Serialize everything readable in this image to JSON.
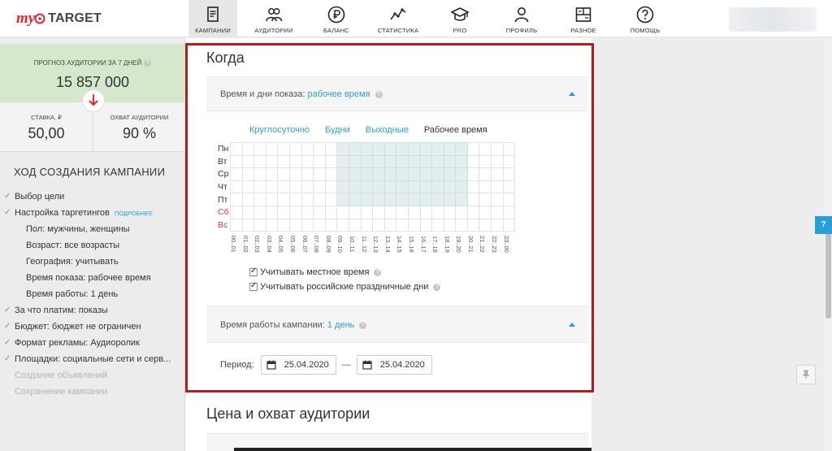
{
  "logo": {
    "my": "my",
    "target": "TARGET"
  },
  "nav": [
    {
      "label": "КАМПАНИИ",
      "icon": "campaigns-icon",
      "active": true
    },
    {
      "label": "АУДИТОРИИ",
      "icon": "audiences-icon",
      "active": false
    },
    {
      "label": "БАЛАНС",
      "icon": "ruble-icon",
      "active": false
    },
    {
      "label": "СТАТИСТИКА",
      "icon": "stats-icon",
      "active": false
    },
    {
      "label": "PRO",
      "icon": "graduation-cap-icon",
      "active": false
    },
    {
      "label": "ПРОФИЛЬ",
      "icon": "profile-icon",
      "active": false
    },
    {
      "label": "РАЗНОЕ",
      "icon": "misc-icon",
      "active": false
    },
    {
      "label": "ПОМОЩЬ",
      "icon": "help-icon",
      "active": false
    }
  ],
  "sidebar": {
    "forecast_label": "ПРОГНОЗ АУДИТОРИИ ЗА 7 ДНЕЙ",
    "forecast_value": "15 857 000",
    "bid_label": "СТАВКА, ₽",
    "bid_value": "50,00",
    "reach_label": "ОХВАТ АУДИТОРИИ",
    "reach_value": "90 %",
    "progress_title": "ХОД СОЗДАНИЯ КАМПАНИИ",
    "steps": [
      {
        "text": "Выбор цели",
        "level": 1,
        "done": true
      },
      {
        "text": "Настройка таргетингов",
        "level": 1,
        "done": true,
        "more": "ПОДРОБНЕЕ"
      },
      {
        "text": "Пол: мужчины, женщины",
        "level": 2
      },
      {
        "text": "Возраст: все возрасты",
        "level": 2
      },
      {
        "text": "География: учитывать",
        "level": 2
      },
      {
        "text": "Время показа: рабочее время",
        "level": 2
      },
      {
        "text": "Время работы: 1 день",
        "level": 2
      },
      {
        "text": "За что платим: показы",
        "level": 1,
        "done": true
      },
      {
        "text": "Бюджет: бюджет не ограничен",
        "level": 1,
        "done": true
      },
      {
        "text": "Формат рекламы: Аудиоролик",
        "level": 1,
        "done": true
      },
      {
        "text": "Площадки: социальные сети и серв...",
        "level": 1,
        "done": true
      },
      {
        "text": "Создание объявлений",
        "level": 1,
        "muted": true
      },
      {
        "text": "Сохранение кампании",
        "level": 1,
        "muted": true
      }
    ]
  },
  "when": {
    "title": "Когда",
    "schedule_label": "Время и дни показа:",
    "schedule_value": "рабочее время",
    "tabs": [
      "Круглосуточно",
      "Будни",
      "Выходные",
      "Рабочее время"
    ],
    "active_tab": 3,
    "days": [
      "Пн",
      "Вт",
      "Ср",
      "Чт",
      "Пт",
      "Сб",
      "Вс"
    ],
    "weekend_days": [
      5,
      6
    ],
    "hours": [
      "00..01",
      "01..02",
      "02..03",
      "03..04",
      "04..05",
      "05..06",
      "06..07",
      "07..08",
      "08..09",
      "09..10",
      "10..11",
      "11..12",
      "12..13",
      "13..14",
      "14..15",
      "15..16",
      "16..17",
      "17..18",
      "18..19",
      "19..20",
      "20..21",
      "21..22",
      "22..23",
      "23..00"
    ],
    "selected_hours": [
      9,
      10,
      11,
      12,
      13,
      14,
      15,
      16,
      17,
      18,
      19
    ],
    "selected_days": [
      0,
      1,
      2,
      3,
      4
    ],
    "local_time_label": "Учитывать местное время",
    "holidays_label": "Учитывать российские праздничные дни",
    "duration_label": "Время работы кампании:",
    "duration_value": "1 день",
    "period_label": "Период:",
    "date_from": "25.04.2020",
    "date_to": "25.04.2020",
    "dash": "—"
  },
  "price": {
    "title": "Цена и охват аудитории"
  },
  "side_help": "?",
  "colors": {
    "accent": "#2a9fd6",
    "brand": "#e8252b",
    "highlight": "#b71c1c",
    "done": "#64b24b",
    "forecast_bg": "#d5e8cc"
  }
}
